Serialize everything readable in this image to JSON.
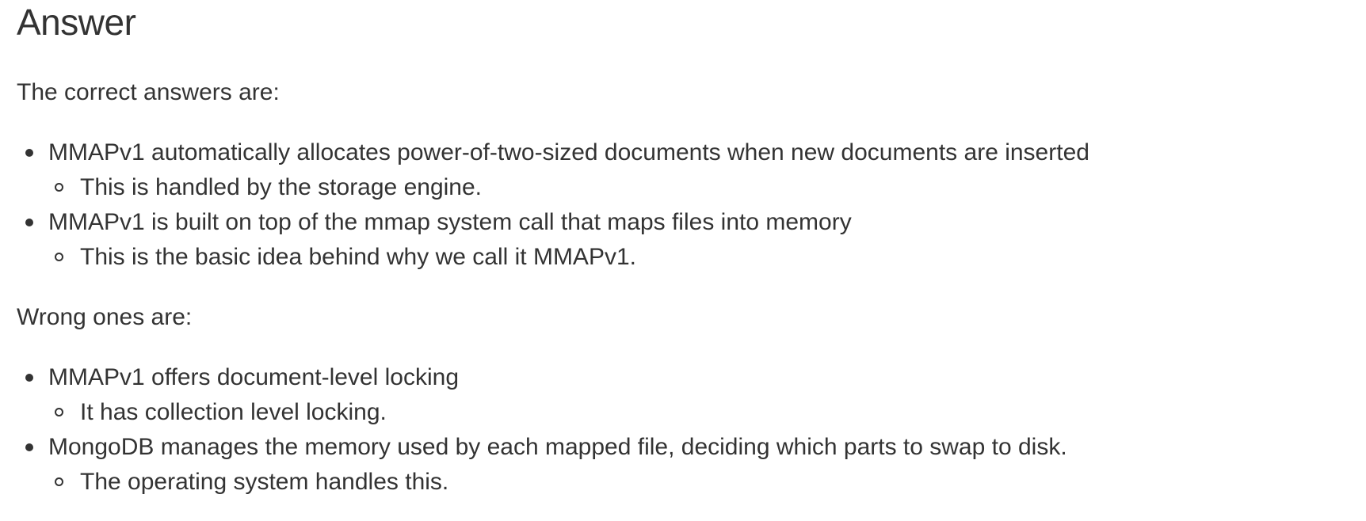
{
  "title": "Answer",
  "correct_intro": "The correct answers are:",
  "correct": [
    {
      "text": "MMAPv1 automatically allocates power-of-two-sized documents when new documents are inserted",
      "note": "This is handled by the storage engine."
    },
    {
      "text": "MMAPv1 is built on top of the mmap system call that maps files into memory",
      "note": "This is the basic idea behind why we call it MMAPv1."
    }
  ],
  "wrong_intro": "Wrong ones are:",
  "wrong": [
    {
      "text": "MMAPv1 offers document-level locking",
      "note": "It has collection level locking."
    },
    {
      "text": "MongoDB manages the memory used by each mapped file, deciding which parts to swap to disk.",
      "note": "The operating system handles this."
    }
  ]
}
